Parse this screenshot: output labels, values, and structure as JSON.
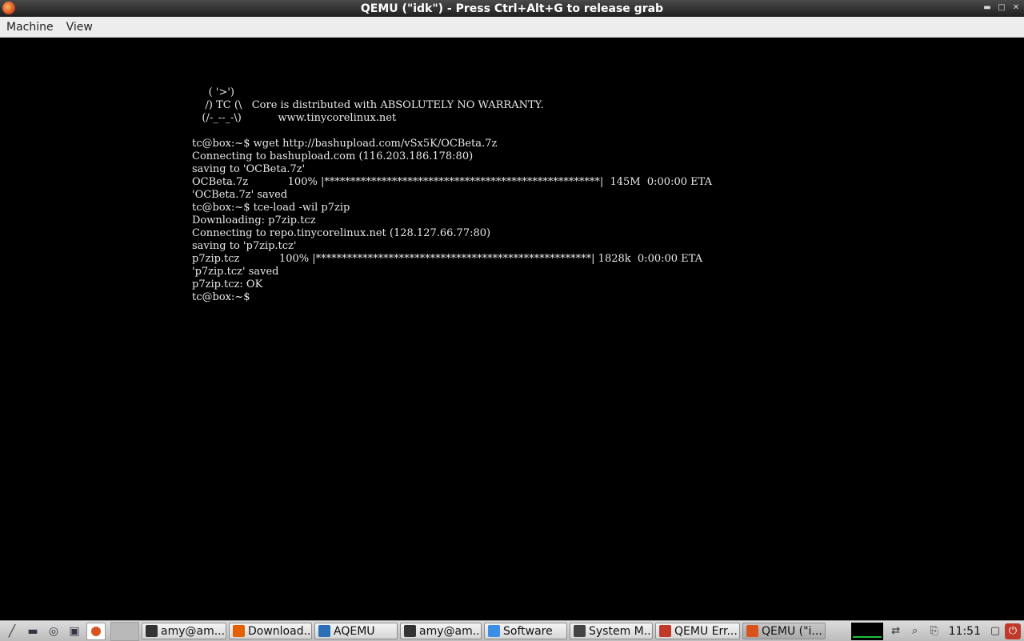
{
  "window": {
    "title": "QEMU (\"idk\") - Press Ctrl+Alt+G to release grab",
    "controls": [
      "minimize-icon",
      "restore-icon",
      "close-icon"
    ]
  },
  "menubar": {
    "items": [
      "Machine",
      "View"
    ]
  },
  "console": {
    "lines": [
      "     ( '>')",
      "    /) TC (\\   Core is distributed with ABSOLUTELY NO WARRANTY.",
      "   (/-_--_-\\)           www.tinycorelinux.net",
      "",
      "tc@box:~$ wget http://bashupload.com/vSx5K/OCBeta.7z",
      "Connecting to bashupload.com (116.203.186.178:80)",
      "saving to 'OCBeta.7z'",
      "OCBeta.7z            100% |*****************************************************|  145M  0:00:00 ETA",
      "'OCBeta.7z' saved",
      "tc@box:~$ tce-load -wil p7zip",
      "Downloading: p7zip.tcz",
      "Connecting to repo.tinycorelinux.net (128.127.66.77:80)",
      "saving to 'p7zip.tcz'",
      "p7zip.tcz            100% |*****************************************************| 1828k  0:00:00 ETA",
      "'p7zip.tcz' saved",
      "p7zip.tcz: OK",
      "tc@box:~$"
    ]
  },
  "taskbar": {
    "tasks": [
      {
        "label": "amy@am...",
        "icon": "terminal-icon",
        "color": "#333333"
      },
      {
        "label": "Download...",
        "icon": "firefox-icon",
        "color": "#e66000"
      },
      {
        "label": "AQEMU",
        "icon": "aqemu-icon",
        "color": "#2a6fb8"
      },
      {
        "label": "amy@am...",
        "icon": "terminal-icon",
        "color": "#333333"
      },
      {
        "label": "Software",
        "icon": "software-icon",
        "color": "#3a8ee6"
      },
      {
        "label": "System M...",
        "icon": "monitor-icon",
        "color": "#444444"
      },
      {
        "label": "QEMU Err...",
        "icon": "bug-icon",
        "color": "#c0392b"
      },
      {
        "label": "QEMU (\"i...",
        "icon": "qemu-icon",
        "color": "#d9531e"
      }
    ],
    "clock": "11:51"
  }
}
